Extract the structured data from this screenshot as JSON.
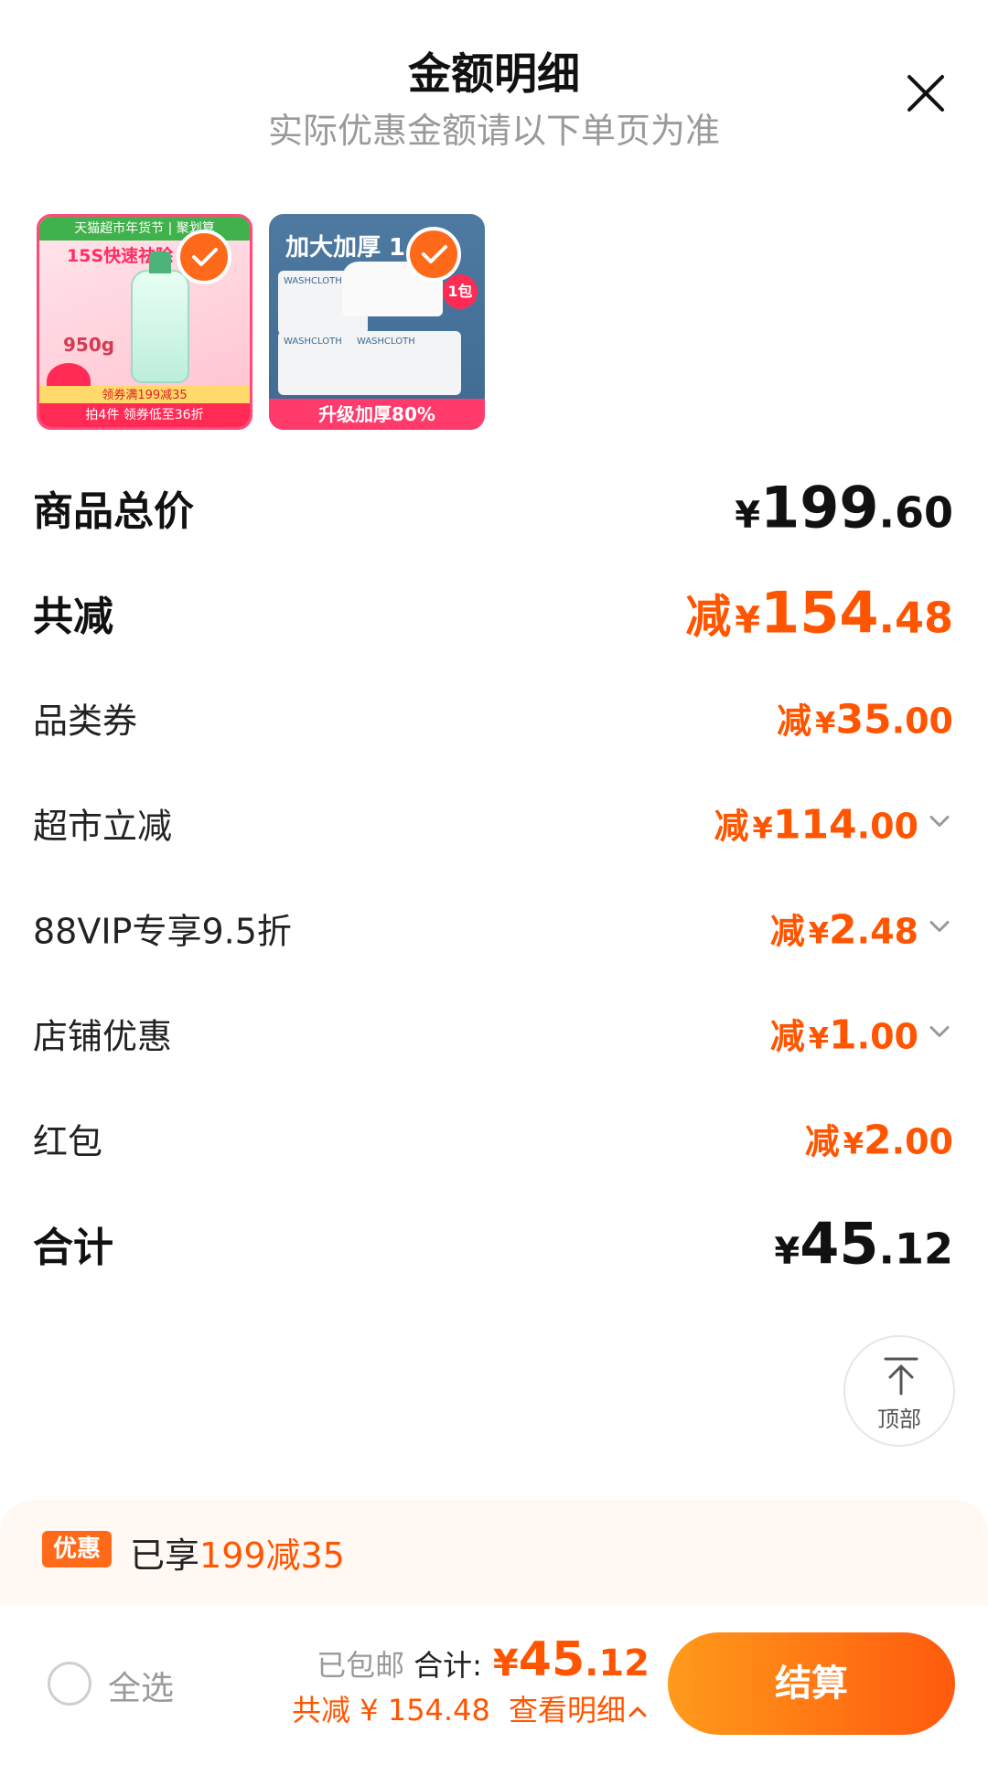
{
  "header": {
    "title": "金额明细",
    "subtitle": "实际优惠金额请以下单页为准"
  },
  "products": [
    {
      "top_banner": "天猫超市年货节 | 聚划算",
      "headline": "15S快速祛除",
      "weight": "950g",
      "promo_band": "领券满199减35",
      "bottom_text": "拍4件 领券低至36折",
      "checked": true
    },
    {
      "headline": "加大加厚 1",
      "pack_label": "WASHCLOTH",
      "badge": "1包",
      "bottom_text": "升级加厚80%",
      "checked": true
    }
  ],
  "rows": [
    {
      "label": "商品总价",
      "prefix": "",
      "yen": "¥",
      "int": "199",
      "dec": ".60",
      "style": "total"
    },
    {
      "label": "共减",
      "prefix": "减",
      "yen": "¥",
      "int": "154",
      "dec": ".48",
      "style": "big-discount"
    },
    {
      "label": "品类券",
      "prefix": "减",
      "yen": "¥",
      "int": "35",
      "dec": ".00",
      "style": "discount",
      "expandable": false
    },
    {
      "label": "超市立减",
      "prefix": "减",
      "yen": "¥",
      "int": "114",
      "dec": ".00",
      "style": "discount",
      "expandable": true
    },
    {
      "label": "88VIP专享9.5折",
      "prefix": "减",
      "yen": "¥",
      "int": "2",
      "dec": ".48",
      "style": "discount",
      "expandable": true
    },
    {
      "label": "店铺优惠",
      "prefix": "减",
      "yen": "¥",
      "int": "1",
      "dec": ".00",
      "style": "discount",
      "expandable": true
    },
    {
      "label": "红包",
      "prefix": "减",
      "yen": "¥",
      "int": "2",
      "dec": ".00",
      "style": "discount",
      "expandable": false
    },
    {
      "label": "合计",
      "prefix": "",
      "yen": "¥",
      "int": "45",
      "dec": ".12",
      "style": "total"
    }
  ],
  "back_to_top": {
    "label": "顶部"
  },
  "promo": {
    "tag": "优惠",
    "text_plain": "已享",
    "text_accent": "199减35"
  },
  "bottom_bar": {
    "select_all": "全选",
    "free_shipping": "已包邮",
    "total_label": "合计:",
    "total_yen": "¥",
    "total_int": "45",
    "total_dec": ".12",
    "saved_text": "共减 ¥ 154.48",
    "detail_link": "查看明细",
    "checkout_label": "结算"
  },
  "colors": {
    "accent": "#ff5500",
    "checkout_start": "#ff9a1a",
    "checkout_end": "#ff5a0e",
    "muted": "#9a9a9a"
  }
}
